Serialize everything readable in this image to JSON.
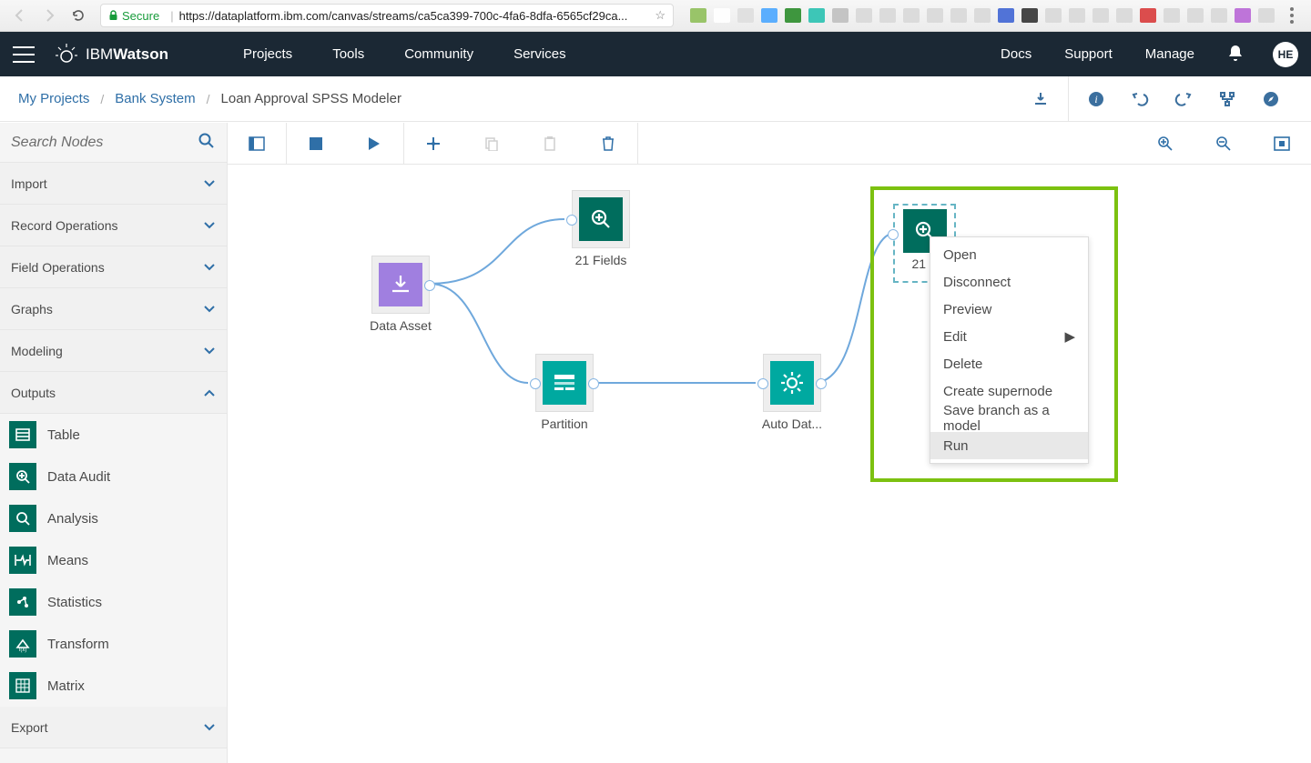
{
  "browser": {
    "secure_label": "Secure",
    "url": "https://dataplatform.ibm.com/canvas/streams/ca5ca399-700c-4fa6-8dfa-6565cf29ca...",
    "extensions": [
      {
        "name": "new",
        "bg": "#8fbf5a"
      },
      {
        "name": "ghost",
        "bg": "#ffffff"
      },
      {
        "name": "abp",
        "bg": "#dedede"
      },
      {
        "name": "cloud",
        "bg": "#4aa6ff"
      },
      {
        "name": "beta",
        "bg": "#2a8c2a"
      },
      {
        "name": "m",
        "bg": "#29c1b0"
      },
      {
        "name": "flower",
        "bg": "#bfbfbf"
      },
      {
        "name": "half",
        "bg": "#d8d8d8"
      },
      {
        "name": "dot",
        "bg": "#d8d8d8"
      },
      {
        "name": "leaf",
        "bg": "#d8d8d8"
      },
      {
        "name": "k",
        "bg": "#d8d8d8"
      },
      {
        "name": "q",
        "bg": "#d8d8d8"
      },
      {
        "name": "ring",
        "bg": "#d8d8d8"
      },
      {
        "name": "sq",
        "bg": "#3f65d4"
      },
      {
        "name": "fquestion",
        "bg": "#333333"
      },
      {
        "name": "ex1",
        "bg": "#d8d8d8"
      },
      {
        "name": "react",
        "bg": "#d8d8d8"
      },
      {
        "name": "v",
        "bg": "#d8d8d8"
      },
      {
        "name": "target",
        "bg": "#d8d8d8"
      },
      {
        "name": "cors",
        "bg": "#d83b3b"
      },
      {
        "name": "flag",
        "bg": "#d8d8d8"
      },
      {
        "name": "box",
        "bg": "#d8d8d8"
      },
      {
        "name": "monitor",
        "bg": "#d8d8d8"
      },
      {
        "name": "rw",
        "bg": "#b866d6"
      },
      {
        "name": "w",
        "bg": "#d8d8d8"
      }
    ]
  },
  "header": {
    "brand_prefix": "IBM ",
    "brand_bold": "Watson",
    "nav": [
      "Projects",
      "Tools",
      "Community",
      "Services"
    ],
    "right_links": [
      "Docs",
      "Support",
      "Manage"
    ],
    "avatar": "HE"
  },
  "breadcrumb": {
    "my_projects": "My Projects",
    "project": "Bank System",
    "current": "Loan Approval SPSS Modeler"
  },
  "palette": {
    "search_placeholder": "Search Nodes",
    "categories": [
      {
        "label": "Import",
        "open": false
      },
      {
        "label": "Record Operations",
        "open": false
      },
      {
        "label": "Field Operations",
        "open": false
      },
      {
        "label": "Graphs",
        "open": false
      },
      {
        "label": "Modeling",
        "open": false
      }
    ],
    "outputs_label": "Outputs",
    "outputs_items": [
      {
        "label": "Table",
        "icon": "table"
      },
      {
        "label": "Data Audit",
        "icon": "audit"
      },
      {
        "label": "Analysis",
        "icon": "analysis"
      },
      {
        "label": "Means",
        "icon": "means"
      },
      {
        "label": "Statistics",
        "icon": "stats"
      },
      {
        "label": "Transform",
        "icon": "transform"
      },
      {
        "label": "Matrix",
        "icon": "matrix"
      }
    ],
    "export_label": "Export"
  },
  "canvas_nodes": {
    "data_asset": "Data Asset",
    "fields21": "21 Fields",
    "partition": "Partition",
    "auto_data": "Auto Dat...",
    "fields21b": "21 F"
  },
  "context_menu": {
    "items": [
      "Open",
      "Disconnect",
      "Preview",
      "Edit",
      "Delete",
      "Create supernode",
      "Save branch as a model",
      "Run"
    ],
    "submenu_index": 3,
    "hover_index": 7
  }
}
